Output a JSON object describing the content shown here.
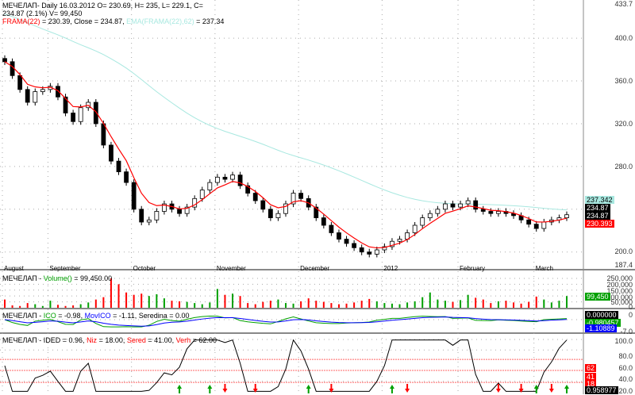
{
  "header": {
    "line1": "МЕЧЕЛАП- Daily 16.03.2012 O= 230.69, H= 235, L= 229.1, C=",
    "line2": "234.87 (2.1%) V= 99,450",
    "frama_label": "FRAMA(22)",
    "frama_rest": " = 230.39, Close = 234.87, ",
    "ema_label": "EMA(FRAMA(22),62)",
    "ema_rest": " = 237.34"
  },
  "volume_header": {
    "prefix": "МЕЧЕЛАП - ",
    "name": "Volume()",
    "rest": " = 99,450.00"
  },
  "ico_header": {
    "prefix": "МЕЧЕЛАП - ",
    "ico": "ICO",
    "ico_val": " = -0.98, ",
    "movico": "MovICO",
    "movico_val": " = -1.11, Seredina = 0.00"
  },
  "ided_header": {
    "prefix": "МЕЧЕЛАП - IDED = 0.96, ",
    "niz": "Niz",
    "niz_val": " = 18.00, ",
    "sered": "Sered",
    "sered_val": " = 41.00, ",
    "verh": "Verh",
    "verh_val": " = 62.00"
  },
  "price_axis": [
    "433.7",
    "400.0",
    "360.0",
    "320.0",
    "280.0",
    "200.0",
    "187.4"
  ],
  "price_tags": {
    "ema": "237.342",
    "close": "234.87",
    "close2": "234.87",
    "frama": "230.393"
  },
  "volume_axis": [
    "250,000",
    "200,000",
    "150,000",
    "100,000",
    "50,000",
    "0"
  ],
  "volume_tag": "99,450",
  "ico_axis": [
    "0",
    "-7.0"
  ],
  "ico_tags": {
    "zero": "0.000000",
    "ico": "-0.980457",
    "movico": "-1.10889"
  },
  "ided_axis": [
    "100.0",
    "80.0",
    "60.0",
    "40.0",
    "20.0"
  ],
  "ided_tags": {
    "verh": "62",
    "sered": "41",
    "niz": "18",
    "ided": "0.958977"
  },
  "colors": {
    "up": "#00a000",
    "down": "#ff0000",
    "frama": "#ff0000",
    "ema": "#a8e8e0",
    "ico": "#00a000",
    "movico": "#0000ff"
  },
  "chart_data": {
    "type": "candlestick",
    "title": "МЕЧЕЛАП- Daily",
    "ylim": [
      187.4,
      433.7
    ],
    "months": [
      {
        "label": "August",
        "i": 0
      },
      {
        "label": "September",
        "i": 6
      },
      {
        "label": "October",
        "i": 17
      },
      {
        "label": "November",
        "i": 28
      },
      {
        "label": "December",
        "i": 39
      },
      {
        "label": "2012",
        "i": 50
      },
      {
        "label": "February",
        "i": 60
      },
      {
        "label": "March",
        "i": 70
      }
    ],
    "close": [
      378,
      365,
      352,
      340,
      350,
      352,
      355,
      345,
      330,
      322,
      335,
      340,
      320,
      300,
      285,
      275,
      265,
      240,
      228,
      230,
      238,
      245,
      240,
      236,
      242,
      250,
      258,
      265,
      270,
      268,
      272,
      262,
      255,
      248,
      240,
      232,
      236,
      245,
      255,
      250,
      242,
      232,
      225,
      218,
      212,
      208,
      204,
      200,
      198,
      202,
      205,
      210,
      212,
      218,
      225,
      232,
      236,
      240,
      245,
      242,
      245,
      248,
      240,
      238,
      236,
      238,
      236,
      234,
      230,
      226,
      222,
      228,
      230,
      232,
      234.87
    ],
    "volume": [
      70,
      20,
      15,
      40,
      30,
      15,
      60,
      25,
      15,
      20,
      30,
      45,
      70,
      90,
      250,
      200,
      130,
      110,
      120,
      100,
      115,
      80,
      60,
      55,
      50,
      40,
      30,
      45,
      160,
      110,
      120,
      100,
      40,
      30,
      50,
      60,
      70,
      40,
      35,
      55,
      80,
      60,
      50,
      40,
      30,
      35,
      45,
      60,
      75,
      55,
      40,
      35,
      30,
      45,
      55,
      90,
      130,
      70,
      60,
      50,
      65,
      110,
      85,
      70,
      40,
      55,
      60,
      45,
      35,
      50,
      95,
      70,
      45,
      60,
      99.45
    ],
    "signals": [
      {
        "i": 23,
        "t": "up"
      },
      {
        "i": 27,
        "t": "up"
      },
      {
        "i": 29,
        "t": "down"
      },
      {
        "i": 33,
        "t": "down"
      },
      {
        "i": 40,
        "t": "up"
      },
      {
        "i": 43,
        "t": "down"
      },
      {
        "i": 51,
        "t": "up"
      },
      {
        "i": 53,
        "t": "down"
      },
      {
        "i": 65,
        "t": "down"
      },
      {
        "i": 68,
        "t": "down"
      },
      {
        "i": 70,
        "t": "up"
      },
      {
        "i": 72,
        "t": "down"
      },
      {
        "i": 74,
        "t": "up"
      }
    ]
  }
}
